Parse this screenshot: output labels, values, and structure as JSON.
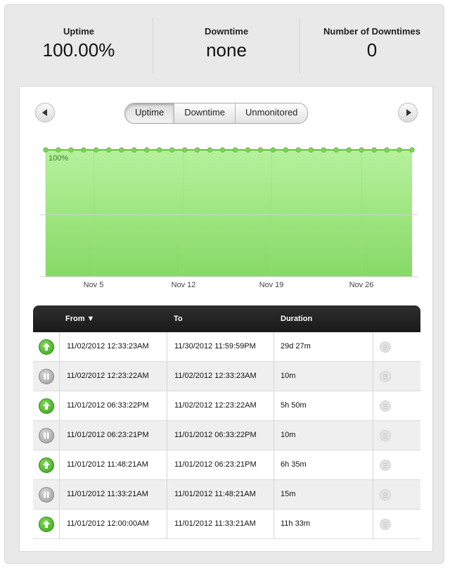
{
  "stats": {
    "uptime": {
      "label": "Uptime",
      "value": "100.00%"
    },
    "downtime": {
      "label": "Downtime",
      "value": "none"
    },
    "count": {
      "label": "Number of Downtimes",
      "value": "0"
    }
  },
  "tabs": [
    {
      "label": "Uptime",
      "active": true
    },
    {
      "label": "Downtime",
      "active": false
    },
    {
      "label": "Unmonitored",
      "active": false
    }
  ],
  "icons": {
    "prev": "chevron-left-icon",
    "next": "chevron-right-icon",
    "up": "arrow-up-icon",
    "paused": "pause-icon",
    "menu": "menu-icon"
  },
  "colors": {
    "area_top": "#b6f29c",
    "area_bottom": "#86d966",
    "line": "#63c23a",
    "status_up": "#4bb82a",
    "status_paused": "#a5a5a5"
  },
  "chart_data": {
    "type": "area",
    "x_tick_labels": [
      "Nov 5",
      "Nov 12",
      "Nov 19",
      "Nov 26"
    ],
    "point_label": "100%",
    "points": 30,
    "y_value": 100,
    "ylim": [
      0,
      100
    ],
    "grid": true
  },
  "table": {
    "headers": {
      "from": "From ▼",
      "to": "To",
      "duration": "Duration"
    },
    "rows": [
      {
        "status": "up",
        "from": "11/02/2012 12:33:23AM",
        "to": "11/30/2012 11:59:59PM",
        "duration": "29d 27m"
      },
      {
        "status": "paused",
        "from": "11/02/2012 12:23:22AM",
        "to": "11/02/2012 12:33:23AM",
        "duration": "10m"
      },
      {
        "status": "up",
        "from": "11/01/2012 06:33:22PM",
        "to": "11/02/2012 12:23:22AM",
        "duration": "5h 50m"
      },
      {
        "status": "paused",
        "from": "11/01/2012 06:23:21PM",
        "to": "11/01/2012 06:33:22PM",
        "duration": "10m"
      },
      {
        "status": "up",
        "from": "11/01/2012 11:48:21AM",
        "to": "11/01/2012 06:23:21PM",
        "duration": "6h 35m"
      },
      {
        "status": "paused",
        "from": "11/01/2012 11:33:21AM",
        "to": "11/01/2012 11:48:21AM",
        "duration": "15m"
      },
      {
        "status": "up",
        "from": "11/01/2012 12:00:00AM",
        "to": "11/01/2012 11:33:21AM",
        "duration": "11h 33m"
      }
    ]
  }
}
